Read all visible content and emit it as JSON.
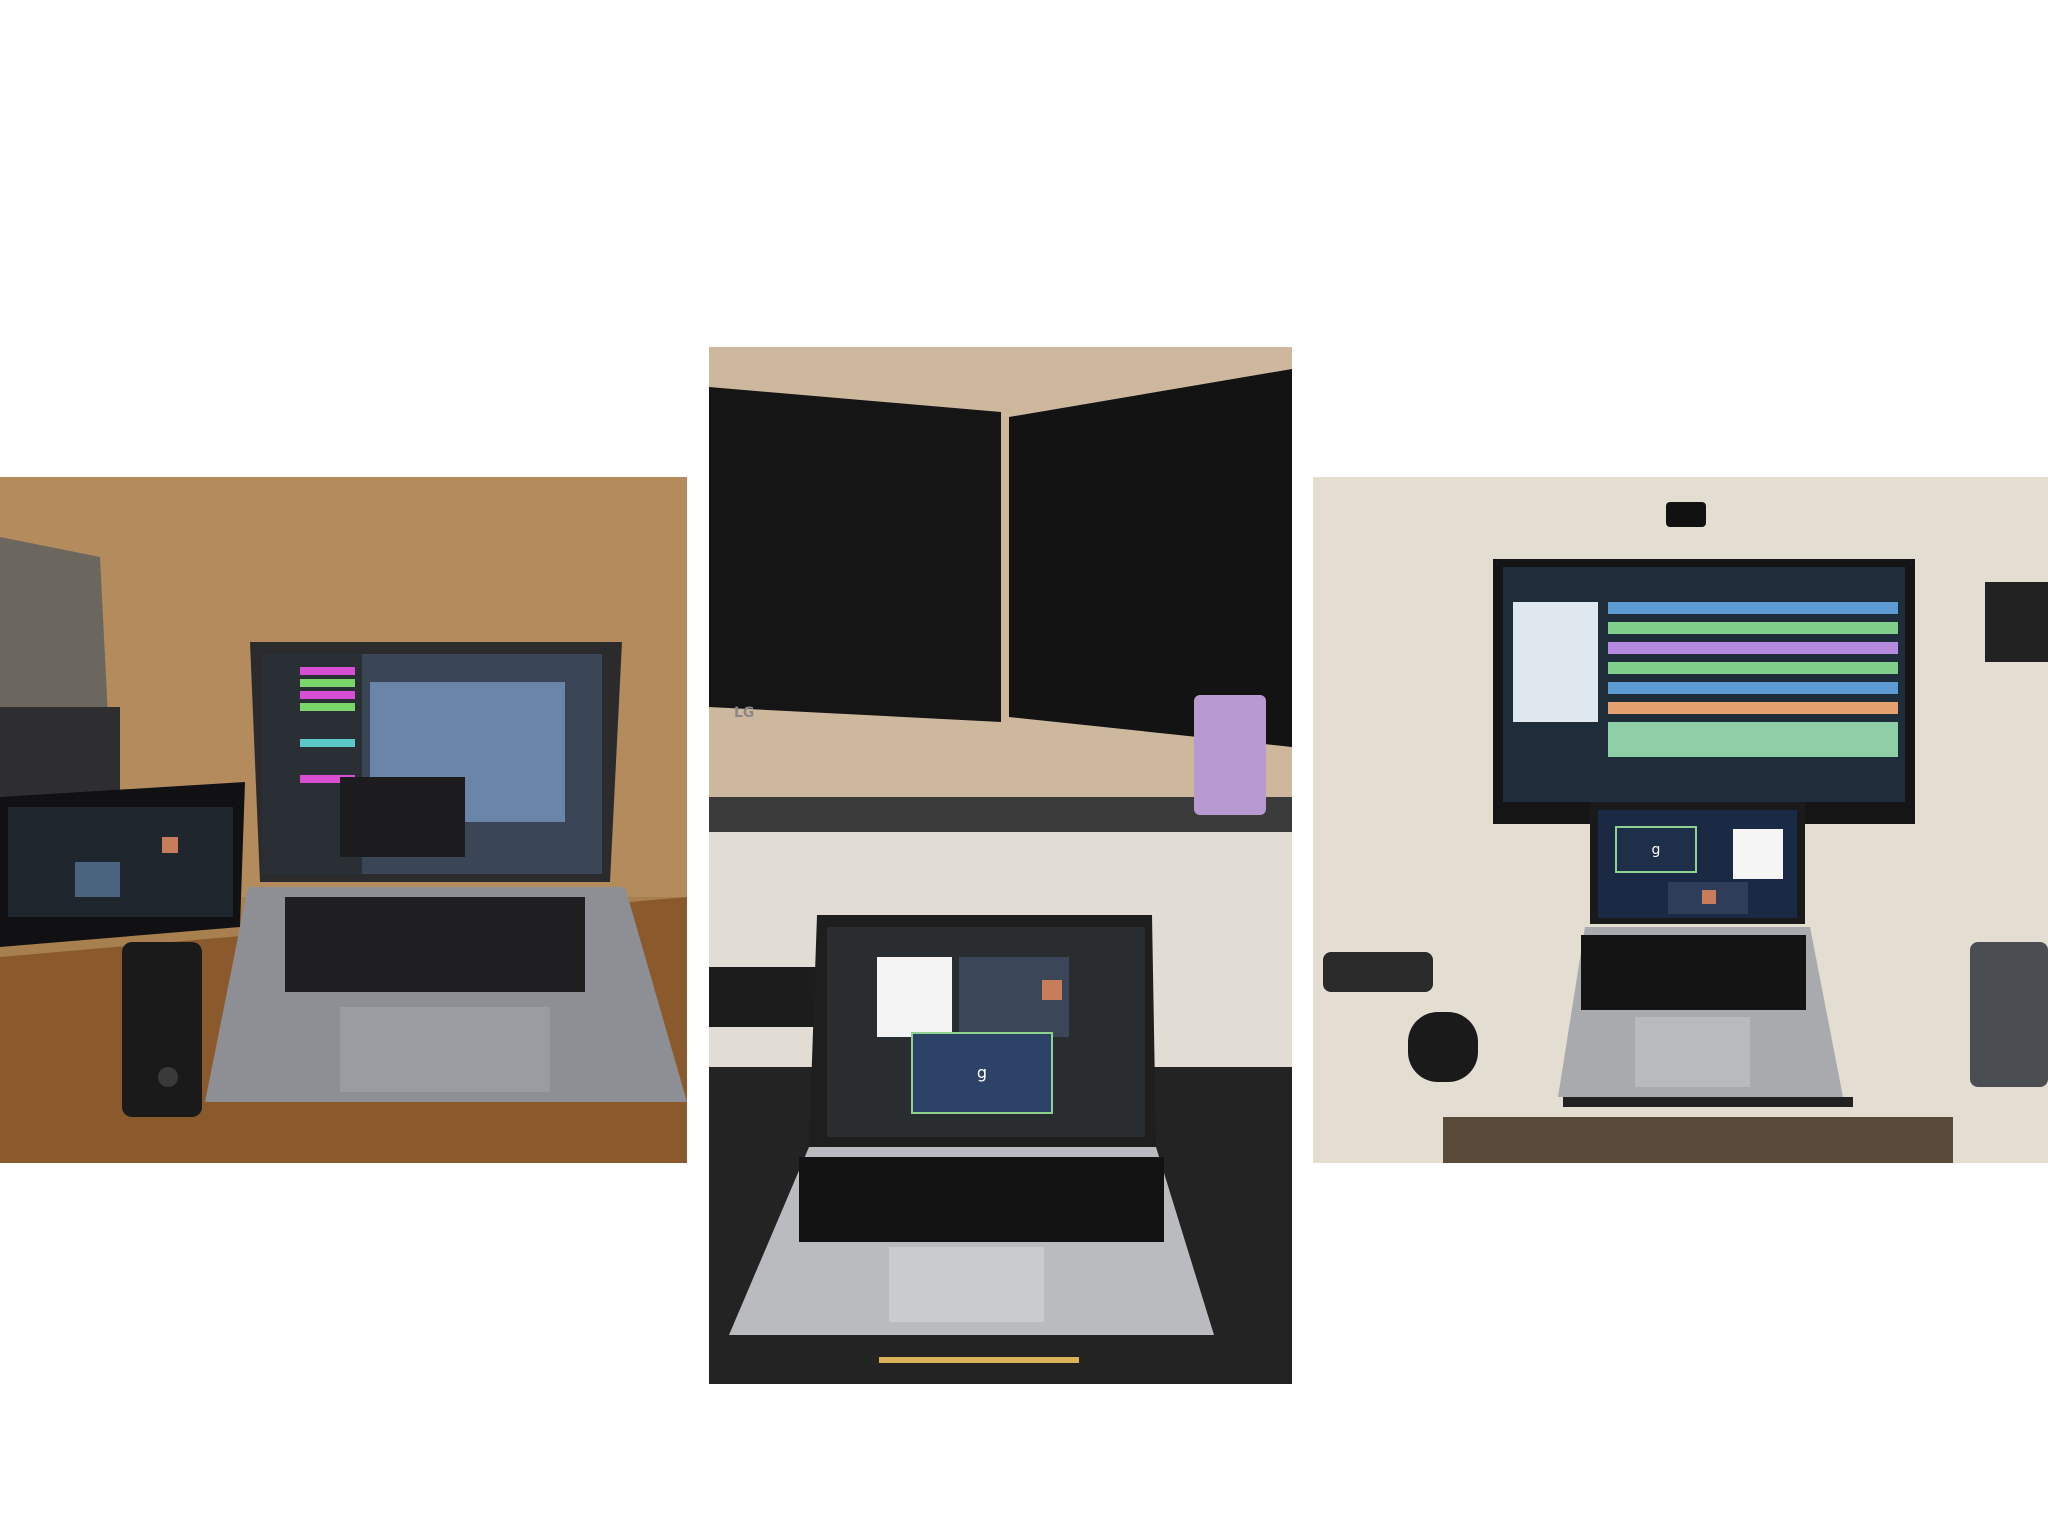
{
  "photos": [
    {
      "id": "left",
      "scene": "laptop-desk-setup",
      "colors": {
        "wall": "#b58a5c",
        "desk": "#9a6a3a",
        "laptop": "#8d8f94",
        "screen_bg": "#3a4556"
      }
    },
    {
      "id": "middle",
      "scene": "dual-monitor-desk",
      "colors": {
        "wall": "#c8b49c",
        "monitor": "#141414",
        "laptop": "#b9bbbe",
        "desk": "#2a2a2a"
      },
      "video_call_tile_letter": "g",
      "monitor_brand": "LG"
    },
    {
      "id": "right",
      "scene": "tv-and-laptop-setup",
      "colors": {
        "wall": "#e6e0d6",
        "tv": "#1a1a1a",
        "laptop": "#a8aaad"
      },
      "video_call_tile_letter": "g"
    }
  ]
}
